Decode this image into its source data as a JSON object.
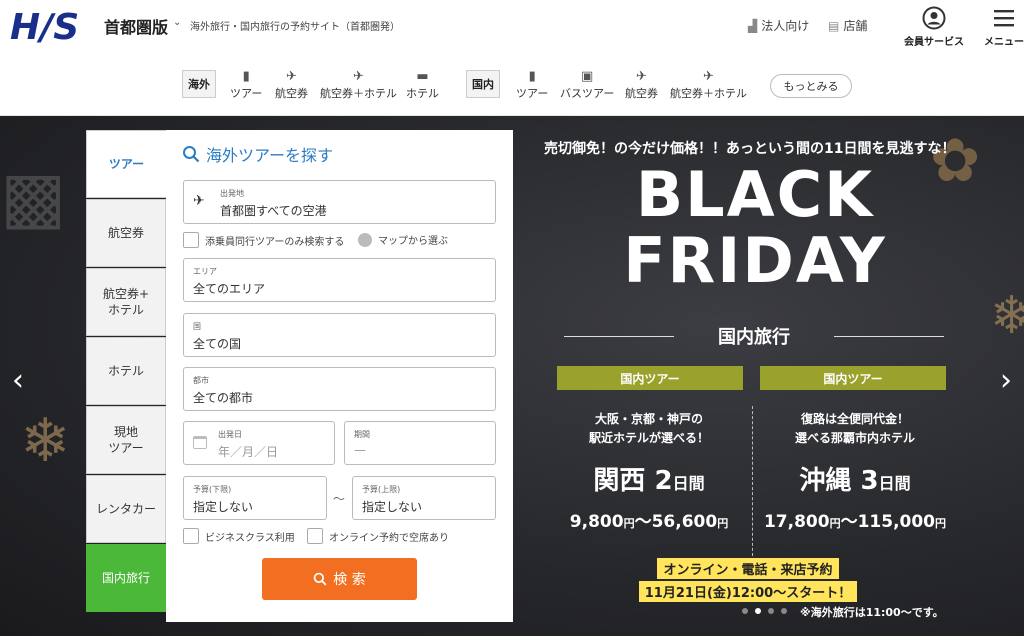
{
  "header": {
    "region": "首都圏版",
    "tagline": "海外旅行・国内旅行の予約サイト（首都圏発）",
    "corporate_label": "法人向け",
    "stores_label": "店舗",
    "member_label": "会員サービス",
    "menu_label": "メニュー"
  },
  "subnav": {
    "overseas_tag": "海外",
    "overseas_items": [
      "ツアー",
      "航空券",
      "航空券＋ホテル",
      "ホテル"
    ],
    "domestic_tag": "国内",
    "domestic_items": [
      "ツアー",
      "バスツアー",
      "航空券",
      "航空券＋ホテル"
    ],
    "more_label": "もっとみる"
  },
  "tabs": [
    "ツアー",
    "航空券",
    "航空券+\nホテル",
    "ホテル",
    "現地\nツアー",
    "レンタカー",
    "国内旅行"
  ],
  "search": {
    "title": "海外ツアーを探す",
    "departure_label": "出発地",
    "departure_value": "首都圏すべての空港",
    "escort_only_label": "添乗員同行ツアーのみ検索する",
    "map_select_label": "マップから選ぶ",
    "area_label": "エリア",
    "area_value": "全てのエリア",
    "country_label": "国",
    "country_value": "全ての国",
    "city_label": "都市",
    "city_value": "全ての都市",
    "date_label": "出発日",
    "date_placeholder": "年／月／日",
    "period_label": "期間",
    "period_placeholder": "—",
    "budget_min_label": "予算(下限)",
    "budget_min_value": "指定しない",
    "budget_max_label": "予算(上限)",
    "budget_max_value": "指定しない",
    "tilde": "〜",
    "business_label": "ビジネスクラス利用",
    "online_label": "オンライン予約で空席あり",
    "search_button": "検 索"
  },
  "promo": {
    "headline": "売切御免！の今だけ価格！！あっという間の11日間を見逃すな！",
    "title_line1": "BLACK",
    "title_line2": "FRIDAY",
    "category": "国内旅行",
    "left": {
      "tag": "国内ツアー",
      "desc1": "大阪・京都・神戸の",
      "desc2": "駅近ホテルが選べる！",
      "dest": "関西",
      "days": "2",
      "days_unit": "日間",
      "price_from": "9,800",
      "price_to": "56,600",
      "yen": "円"
    },
    "right": {
      "tag": "国内ツアー",
      "desc1": "復路は全便同代金！",
      "desc2": "選べる那覇市内ホテル",
      "dest": "沖縄",
      "days": "3",
      "days_unit": "日間",
      "price_from": "17,800",
      "price_to": "115,000",
      "yen": "円"
    },
    "tilde": "〜",
    "banner_line1": "オンライン・電話・来店予約",
    "banner_line2": "11月21日(金)12:00〜スタート！",
    "note": "※海外旅行は11:00〜です。"
  },
  "colors": {
    "brand_blue": "#1a2f8a",
    "link_blue": "#2b7cc4",
    "search_orange": "#f26f21",
    "domestic_green": "#4cb83a",
    "tag_olive": "#9aa12c",
    "banner_yellow": "#ffe45c"
  },
  "icons": [
    "his-logo",
    "chevron-down-icon",
    "building-icon",
    "store-icon",
    "user-circle-icon",
    "hamburger-icon",
    "suitcase-icon",
    "plane-icon",
    "plane-hotel-icon",
    "bed-icon",
    "bus-icon",
    "search-icon",
    "departure-plane-icon",
    "map-pin-icon",
    "calendar-icon",
    "chevron-left-icon",
    "chevron-right-icon"
  ]
}
